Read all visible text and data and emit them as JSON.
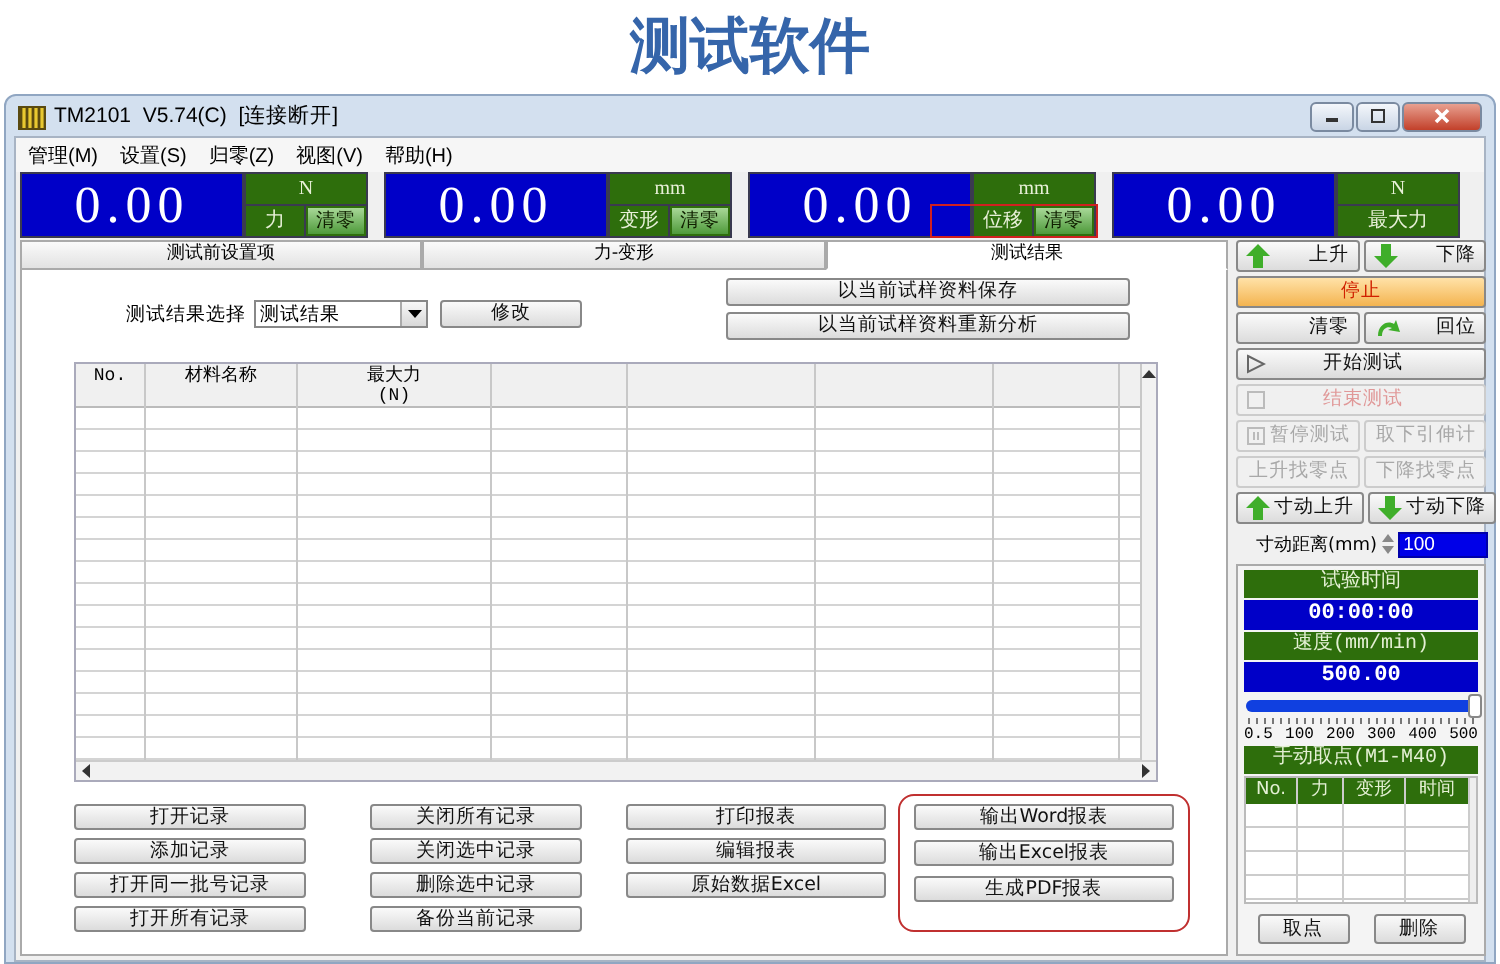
{
  "heading": "测试软件",
  "window": {
    "title": "TM2101  V5.74(C)  [连接断开]"
  },
  "menu": [
    "管理(M)",
    "设置(S)",
    "归零(Z)",
    "视图(V)",
    "帮助(H)"
  ],
  "readouts": [
    {
      "reading": "0.00",
      "unit": "N",
      "channel": "力",
      "clear": "清零",
      "annotated": false
    },
    {
      "reading": "0.00",
      "unit": "mm",
      "channel": "变形",
      "clear": "清零",
      "annotated": false
    },
    {
      "reading": "0.00",
      "unit": "mm",
      "channel": "位移",
      "clear": "清零",
      "annotated": true
    },
    {
      "reading": "0.00",
      "unit": "N",
      "channel": "最大力",
      "annotated": false
    }
  ],
  "tabs": [
    {
      "label": "测试前设置项",
      "selected": false
    },
    {
      "label": "力-变形",
      "selected": false
    },
    {
      "label": "测试结果",
      "selected": true
    }
  ],
  "result_select": {
    "label": "测试结果选择",
    "value": "测试结果",
    "button": "修改"
  },
  "sample_buttons": [
    "以当前试样资料保存",
    "以当前试样资料重新分析"
  ],
  "table": {
    "columns": [
      "No.",
      "材料名称",
      "最大力\n(N)"
    ]
  },
  "record_buttons": [
    {
      "annotated": false,
      "buttons": [
        "打开记录",
        "添加记录",
        "打开同一批号记录",
        "打开所有记录"
      ]
    },
    {
      "annotated": false,
      "buttons": [
        "关闭所有记录",
        "关闭选中记录",
        "删除选中记录",
        "备份当前记录"
      ]
    },
    {
      "annotated": false,
      "buttons": [
        "打印报表",
        "编辑报表",
        "原始数据Excel"
      ]
    },
    {
      "annotated": true,
      "buttons": [
        "输出Word报表",
        "输出Excel报表",
        "生成PDF报表"
      ]
    }
  ],
  "controls": [
    {
      "buttons": [
        {
          "label": "上升",
          "kind": "up",
          "disabled": false
        },
        {
          "label": "下降",
          "kind": "down",
          "disabled": false
        }
      ]
    },
    {
      "buttons": [
        {
          "label": "停止",
          "kind": "stop",
          "disabled": false
        }
      ]
    },
    {
      "buttons": [
        {
          "label": "清零",
          "kind": "plain",
          "disabled": false
        },
        {
          "label": "回位",
          "kind": "return",
          "disabled": false
        }
      ]
    },
    {
      "buttons": [
        {
          "label": "开始测试",
          "kind": "start",
          "disabled": false
        }
      ]
    },
    {
      "buttons": [
        {
          "label": "结束测试",
          "kind": "check",
          "disabled": true
        }
      ]
    },
    {
      "buttons": [
        {
          "label": "暂停测试",
          "kind": "pause",
          "disabled": true
        },
        {
          "label": "取下引伸计",
          "kind": "plain",
          "disabled": true
        }
      ]
    },
    {
      "buttons": [
        {
          "label": "上升找零点",
          "kind": "plain",
          "disabled": true
        },
        {
          "label": "下降找零点",
          "kind": "plain",
          "disabled": true
        }
      ]
    },
    {
      "buttons": [
        {
          "label": "寸动上升",
          "kind": "up",
          "disabled": false
        },
        {
          "label": "寸动下降",
          "kind": "down",
          "disabled": false
        }
      ]
    }
  ],
  "jog": {
    "label": "寸动距离(mm)",
    "value": "100"
  },
  "test_time": {
    "label": "试验时间",
    "value": "00:00:00"
  },
  "speed": {
    "label": "速度(mm/min)",
    "value": "500.00",
    "level": 1,
    "ticks": [
      "0.5",
      "100",
      "200",
      "300",
      "400",
      "500"
    ]
  },
  "manual_points": {
    "title": "手动取点(M1-M40)",
    "columns": [
      "No.",
      "力",
      "变形",
      "时间"
    ],
    "buttons": [
      "取点",
      "删除"
    ]
  }
}
